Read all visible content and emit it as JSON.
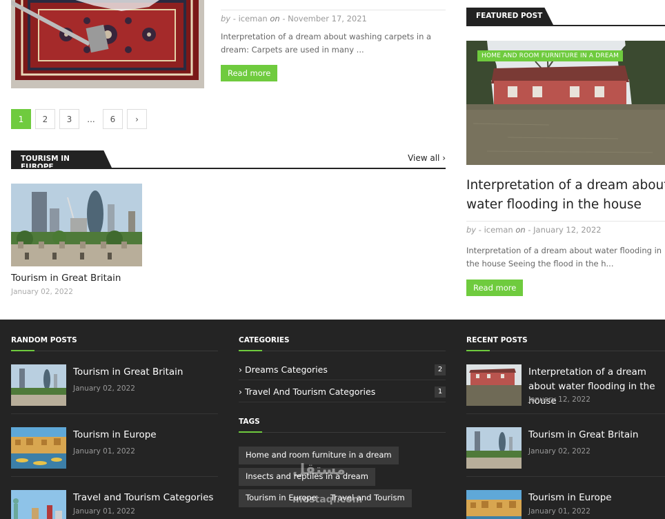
{
  "latest_post": {
    "by": "by",
    "author": "- iceman",
    "on": "on",
    "date": "- November 17, 2021",
    "excerpt": "Interpretation of a dream about washing carpets in a dream: Carpets are used in many ...",
    "read_more": "Read more"
  },
  "pagination": {
    "pages": [
      "1",
      "2",
      "3"
    ],
    "ellipsis": "...",
    "last": "6",
    "next": "›"
  },
  "europe_section": {
    "title": "TOURISM IN EUROPE",
    "view_all": "View all ›",
    "card": {
      "title": "Tourism in Great Britain",
      "date": "January 02, 2022"
    }
  },
  "featured": {
    "heading": "FEATURED POST",
    "badge": "HOME AND ROOM FURNITURE IN A DREAM",
    "title": "Interpretation of a dream about water flooding in the house",
    "by": "by",
    "author": "- iceman",
    "on": "on",
    "date": "- January 12, 2022",
    "excerpt": "Interpretation of a dream about water flooding in the house Seeing the flood in the h...",
    "read_more": "Read more"
  },
  "footer": {
    "random": {
      "heading": "RANDOM POSTS",
      "items": [
        {
          "title": "Tourism in Great Britain",
          "date": "January 02, 2022"
        },
        {
          "title": "Tourism in Europe",
          "date": "January 01, 2022"
        },
        {
          "title": "Travel and Tourism Categories",
          "date": "January 01, 2022"
        }
      ]
    },
    "categories": {
      "heading": "CATEGORIES",
      "items": [
        {
          "label": "› Dreams Categories",
          "count": "2"
        },
        {
          "label": "› Travel And Tourism Categories",
          "count": "1"
        }
      ]
    },
    "tags": {
      "heading": "TAGS",
      "items": [
        "Home and room furniture in a dream",
        "Insects and reptiles in a dream",
        "Tourism in Europe",
        "Travel and Tourism"
      ]
    },
    "recent": {
      "heading": "RECENT POSTS",
      "items": [
        {
          "title": "Interpretation of a dream about water flooding in the house",
          "date": "January 12, 2022"
        },
        {
          "title": "Tourism in Great Britain",
          "date": "January 02, 2022"
        },
        {
          "title": "Tourism in Europe",
          "date": "January 01, 2022"
        }
      ]
    },
    "watermark": "مستقل",
    "watermark_sub": "mostaql.com"
  },
  "colors": {
    "accent": "#6fcb3e",
    "dark": "#222222",
    "footer_bg": "#242424"
  }
}
